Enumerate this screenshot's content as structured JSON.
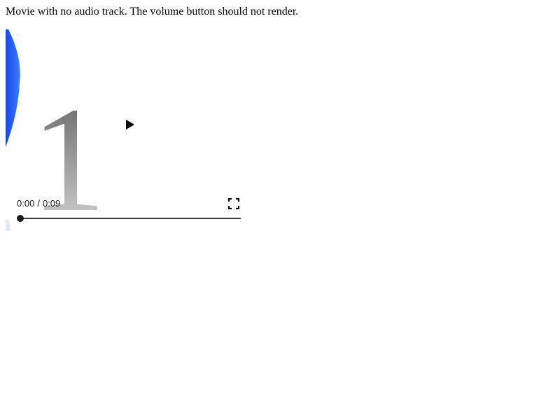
{
  "page": {
    "description": "Movie with no audio track. The volume button should not render."
  },
  "video": {
    "frame_digit": "1",
    "state": "paused",
    "current_time": "0:00",
    "time_separator": "/",
    "duration": "0:09",
    "progress_fraction": 0,
    "controls": {
      "play_icon": "play-icon",
      "fullscreen_icon": "fullscreen-icon"
    },
    "colors": {
      "accent_blue": "#1f5cf0",
      "digit_dark": "#5a5a5a",
      "digit_light": "#d9d9d9",
      "control_dark": "#1a1a1a"
    }
  }
}
